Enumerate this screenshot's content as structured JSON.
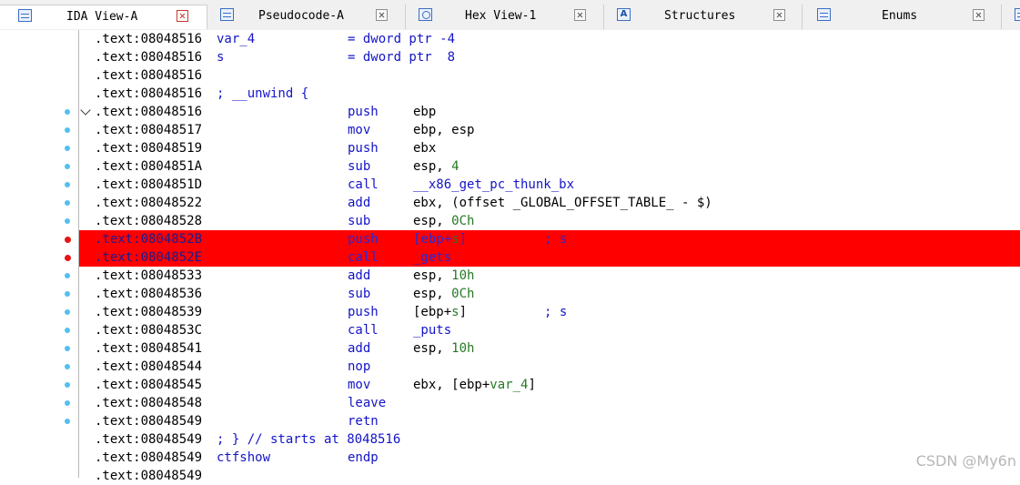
{
  "tabs": [
    {
      "label": "IDA View-A",
      "icon": "disassembly-view-icon",
      "active": true
    },
    {
      "label": "Pseudocode-A",
      "icon": "pseudocode-view-icon",
      "active": false
    },
    {
      "label": "Hex View-1",
      "icon": "hex-view-icon",
      "active": false
    },
    {
      "label": "Structures",
      "icon": "structures-icon",
      "icon_glyph": "A",
      "active": false
    },
    {
      "label": "Enums",
      "icon": "enums-icon",
      "active": false
    }
  ],
  "colors": {
    "breakpoint_highlight": "#ff0000",
    "mnemonic": "#1414c8",
    "number": "#247a24",
    "gutter_dot": "#52c0ee",
    "breakpoint_dot": "#e61414"
  },
  "listing": [
    {
      "addr": ".text:08048516",
      "lbl": "var_4",
      "mn": "= dword ptr -4"
    },
    {
      "addr": ".text:08048516",
      "lbl": "s",
      "mn": "= dword ptr  8"
    },
    {
      "addr": ".text:08048516"
    },
    {
      "addr": ".text:08048516",
      "cmt": "; __unwind {"
    },
    {
      "addr": ".text:08048516",
      "mn": "push",
      "op": "ebp"
    },
    {
      "addr": ".text:08048517",
      "mn": "mov",
      "op": "ebp, esp"
    },
    {
      "addr": ".text:08048519",
      "mn": "push",
      "op": "ebx"
    },
    {
      "addr": ".text:0804851A",
      "mn": "sub",
      "op": "esp, 4"
    },
    {
      "addr": ".text:0804851D",
      "mn": "call",
      "op": "__x86_get_pc_thunk_bx"
    },
    {
      "addr": ".text:08048522",
      "mn": "add",
      "op": "ebx, (offset _GLOBAL_OFFSET_TABLE_ - $)"
    },
    {
      "addr": ".text:08048528",
      "mn": "sub",
      "op": "esp, 0Ch"
    },
    {
      "addr": ".text:0804852B",
      "mn": "push",
      "op": "[ebp+s]",
      "tc": "; s",
      "breakpoint": true
    },
    {
      "addr": ".text:0804852E",
      "mn": "call",
      "op": "_gets",
      "breakpoint": true
    },
    {
      "addr": ".text:08048533",
      "mn": "add",
      "op": "esp, 10h"
    },
    {
      "addr": ".text:08048536",
      "mn": "sub",
      "op": "esp, 0Ch"
    },
    {
      "addr": ".text:08048539",
      "mn": "push",
      "op": "[ebp+s]",
      "tc": "; s"
    },
    {
      "addr": ".text:0804853C",
      "mn": "call",
      "op": "_puts"
    },
    {
      "addr": ".text:08048541",
      "mn": "add",
      "op": "esp, 10h"
    },
    {
      "addr": ".text:08048544",
      "mn": "nop"
    },
    {
      "addr": ".text:08048545",
      "mn": "mov",
      "op": "ebx, [ebp+var_4]"
    },
    {
      "addr": ".text:08048548",
      "mn": "leave"
    },
    {
      "addr": ".text:08048549",
      "mn": "retn"
    },
    {
      "addr": ".text:08048549",
      "cmt": "; } // starts at 8048516"
    },
    {
      "addr": ".text:08048549",
      "lbl": "ctfshow",
      "mn": "endp"
    },
    {
      "addr": ".text:08048549"
    }
  ],
  "watermark": "CSDN @My6n"
}
